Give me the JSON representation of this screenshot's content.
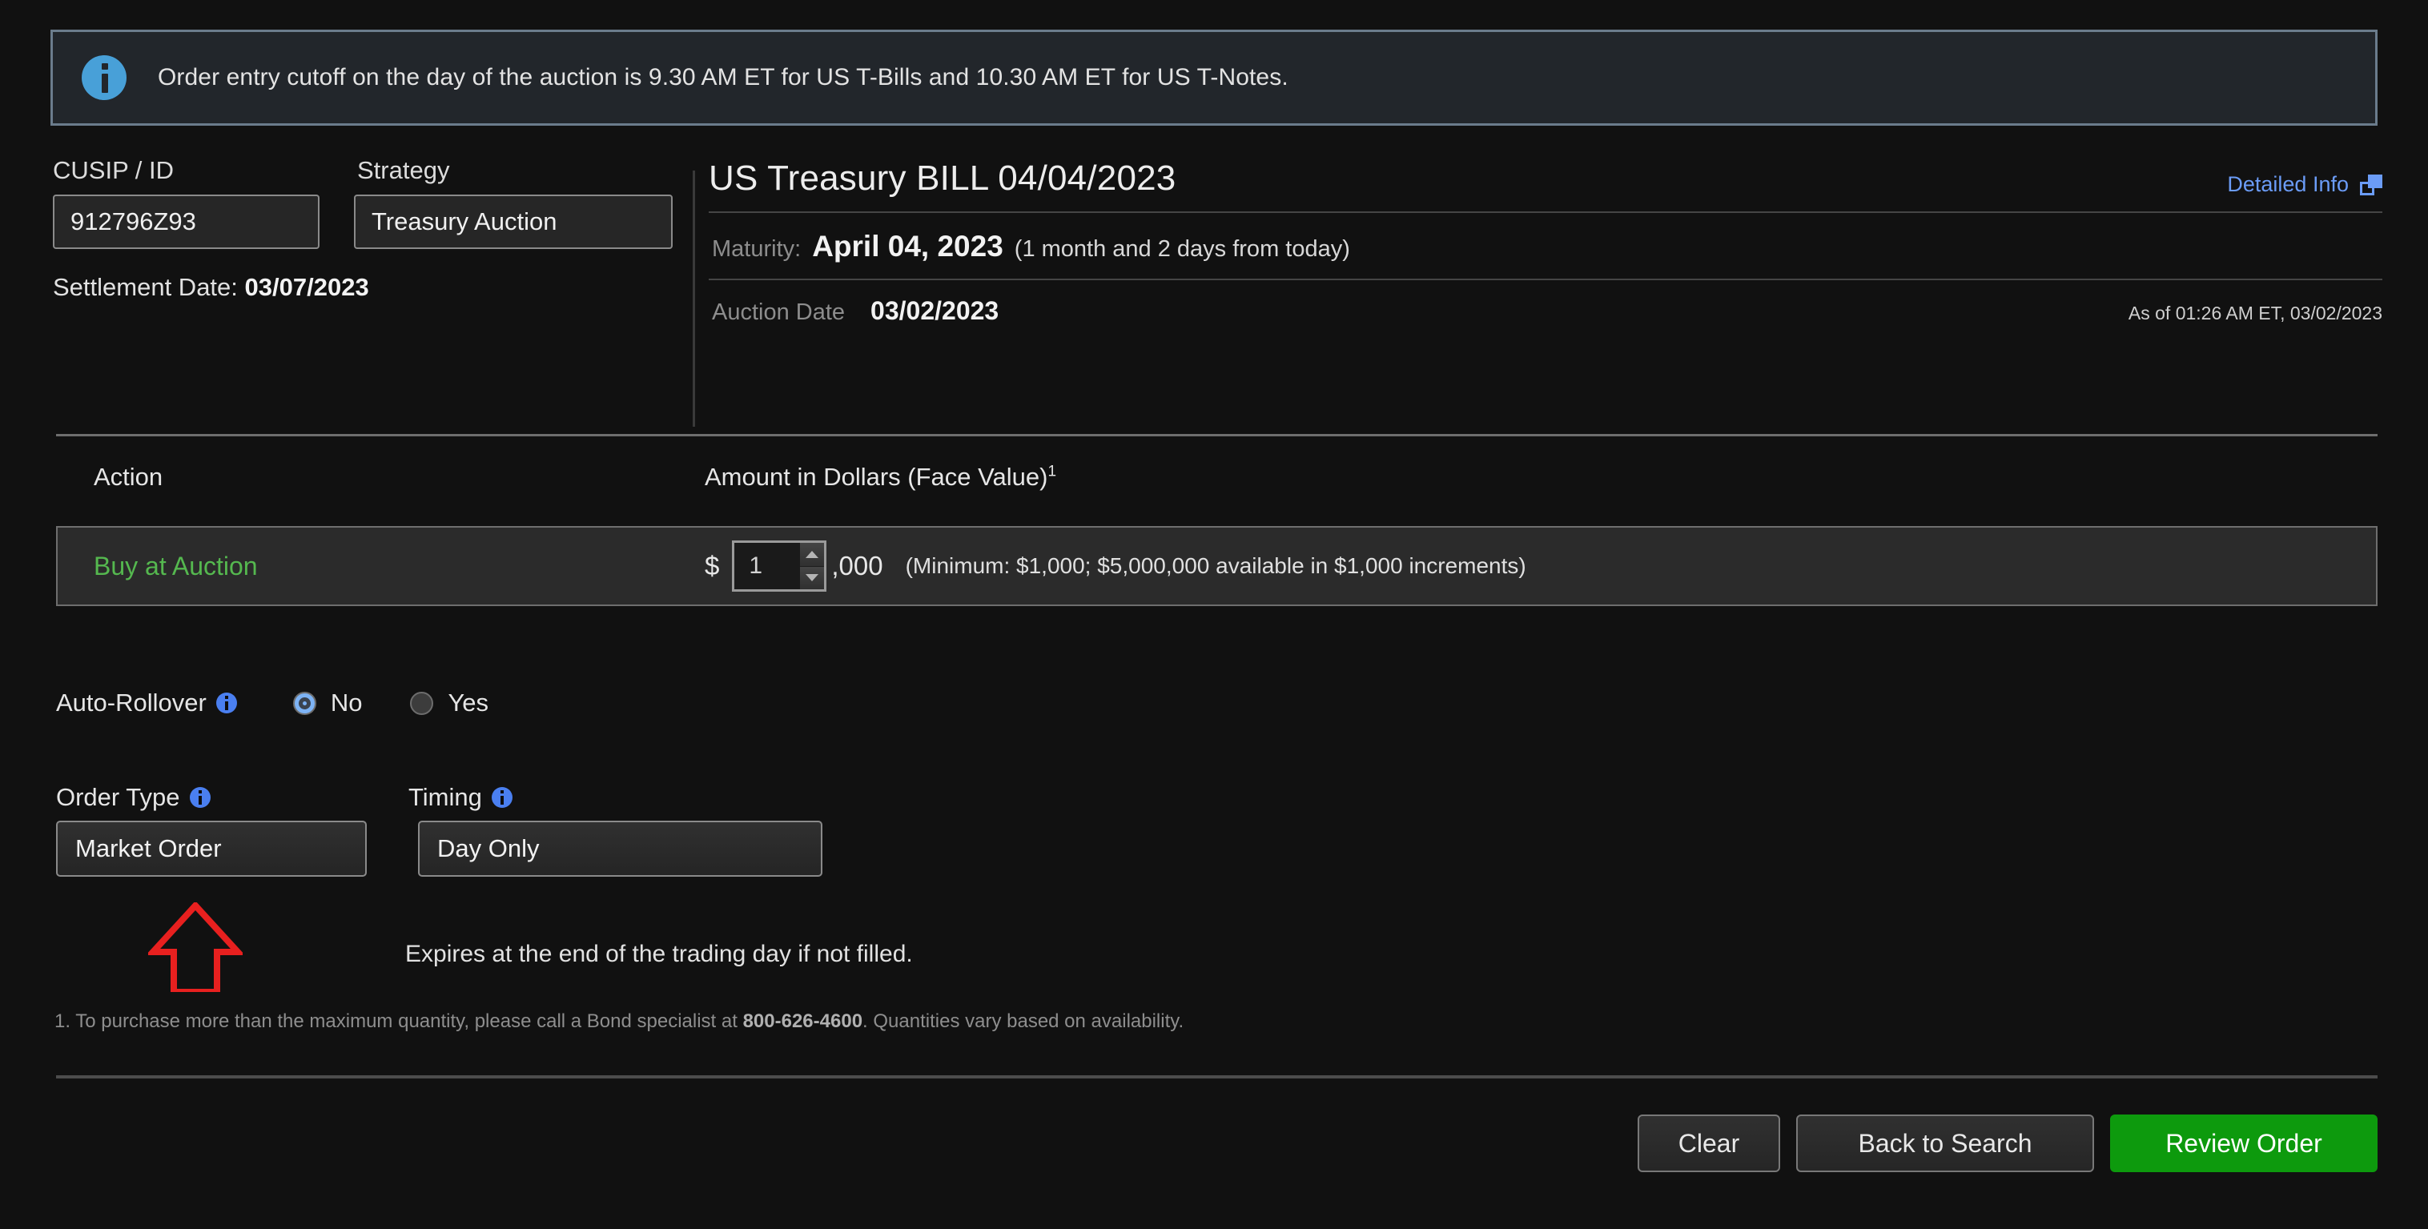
{
  "banner": {
    "icon": "info-circle-icon",
    "message": "Order entry cutoff on the day of the auction is 9.30 AM ET for US T-Bills and 10.30 AM ET for US T-Notes."
  },
  "left_panel": {
    "cusip_label": "CUSIP / ID",
    "cusip_value": "912796Z93",
    "strategy_label": "Strategy",
    "strategy_value": "Treasury Auction",
    "settlement_label": "Settlement Date:",
    "settlement_value": "03/07/2023"
  },
  "security": {
    "title": "US Treasury BILL 04/04/2023",
    "detailed_info_label": "Detailed Info",
    "detailed_info_icon": "external-window-icon",
    "maturity_label": "Maturity:",
    "maturity_value": "April 04, 2023",
    "maturity_note": "(1 month and 2 days from today)",
    "auction_label": "Auction Date",
    "auction_value": "03/02/2023",
    "as_of": "As of 01:26 AM ET, 03/02/2023"
  },
  "order_table": {
    "header_action": "Action",
    "header_amount": "Amount in Dollars (Face Value)",
    "header_amount_footnote": "1",
    "action_value": "Buy at Auction",
    "currency_symbol": "$",
    "amount_value": "1",
    "amount_suffix": ",000",
    "amount_note": "(Minimum: $1,000; $5,000,000 available in $1,000 increments)",
    "spinner_up_icon": "triangle-up-icon",
    "spinner_down_icon": "triangle-down-icon"
  },
  "auto_rollover": {
    "label": "Auto-Rollover",
    "info_icon": "info-tooltip-icon",
    "options": [
      {
        "label": "No",
        "selected": true
      },
      {
        "label": "Yes",
        "selected": false
      }
    ]
  },
  "order_type": {
    "label": "Order Type",
    "info_icon": "info-tooltip-icon",
    "value": "Market Order"
  },
  "timing": {
    "label": "Timing",
    "info_icon": "info-tooltip-icon",
    "value": "Day Only",
    "note": "Expires at the end of the trading day if not filled."
  },
  "annotation": {
    "arrow_icon": "red-up-arrow-annotation",
    "color": "#e8201f"
  },
  "footnote": {
    "prefix": "1. To purchase more than the maximum quantity, please call a Bond specialist  at ",
    "phone": "800-626-4600",
    "suffix": ". Quantities vary based on availability."
  },
  "buttons": {
    "clear": "Clear",
    "back_to_search": "Back to Search",
    "review_order": "Review Order"
  },
  "colors": {
    "background": "#111111",
    "banner_bg": "#22262b",
    "banner_border": "#6b7c8c",
    "info_blue": "#48a0d8",
    "link_blue": "#6b9cf7",
    "buy_green": "#55b84f",
    "review_green": "#0d9a0d",
    "annotation_red": "#e8201f"
  }
}
